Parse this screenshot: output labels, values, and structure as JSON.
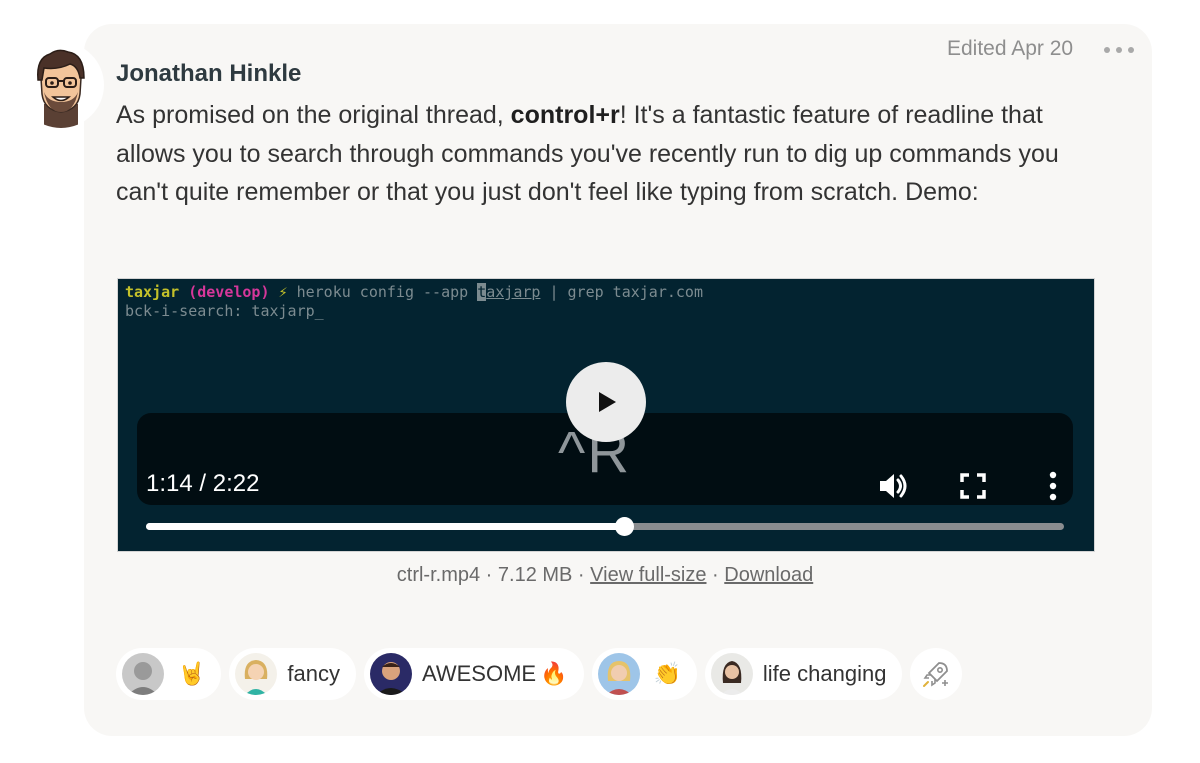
{
  "post": {
    "author": "Jonathan Hinkle",
    "timestamp": "Edited Apr 20",
    "body_1": "As promised on the original thread, ",
    "body_bold": "control+r",
    "body_2": "!  It's a fantastic feature of readline that allows you to search through commands you've recently run to dig up commands you can't quite remember or that you just don't feel like typing from scratch.  Demo:"
  },
  "video": {
    "terminal": {
      "dir": "taxjar",
      "branch": "(develop)",
      "bolt": "⚡",
      "cmd_before": " heroku config --app ",
      "cmd_hl": "t",
      "cmd_ul": "axjarp",
      "cmd_after": " | grep taxjar.com",
      "line2": "bck-i-search: taxjarp_"
    },
    "key_hint": "^R",
    "time_display": "1:14 / 2:22",
    "progress": 0.521
  },
  "attachment": {
    "filename": "ctrl-r.mp4",
    "sep1": " · ",
    "size": "7.12 MB",
    "sep2": " · ",
    "view_label": "View full-size",
    "sep3": " · ",
    "download_label": "Download"
  },
  "reactions": [
    {
      "emoji": "🤘"
    },
    {
      "label": "fancy"
    },
    {
      "label": "AWESOME",
      "emoji": "🔥"
    },
    {
      "emoji": "👏"
    },
    {
      "label": "life changing"
    }
  ],
  "icons": {
    "more": "more-horizontal-icon",
    "play": "play-icon",
    "volume": "volume-icon",
    "fullscreen": "fullscreen-icon",
    "video_menu": "more-vertical-icon",
    "add_reaction": "rocket-icon"
  }
}
